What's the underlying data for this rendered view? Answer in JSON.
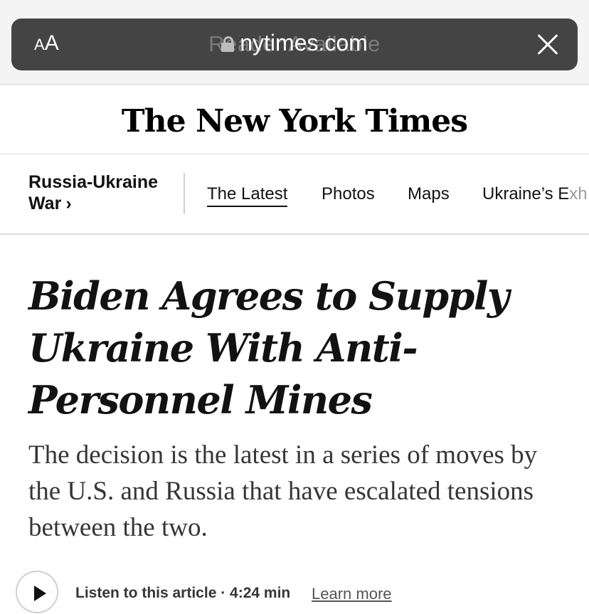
{
  "browser": {
    "text_size_small": "A",
    "text_size_large": "A",
    "url": "nytimes.com",
    "ghost_title": "Reader Available",
    "lock_icon": "lock-icon",
    "close_icon": "close-icon"
  },
  "masthead": {
    "logo_text": "The New York Times"
  },
  "subnav": {
    "section_label": "Russia-Ukraine War",
    "section_chevron": "›",
    "items": [
      {
        "label": "The Latest",
        "active": true
      },
      {
        "label": "Photos",
        "active": false
      },
      {
        "label": "Maps",
        "active": false
      },
      {
        "label": "Ukraine’s Exh",
        "active": false
      }
    ]
  },
  "article": {
    "headline": "Biden Agrees to Supply Ukraine With Anti-Personnel Mines",
    "summary": "The decision is the latest in a series of moves by the U.S. and Russia that have escalated tensions between the two.",
    "listen_label": "Listen to this article · 4:24 min",
    "learn_more": "Learn more",
    "play_icon": "play-icon"
  },
  "colors": {
    "url_bar": "#444444",
    "text": "#121212",
    "summary_text": "#363636"
  }
}
